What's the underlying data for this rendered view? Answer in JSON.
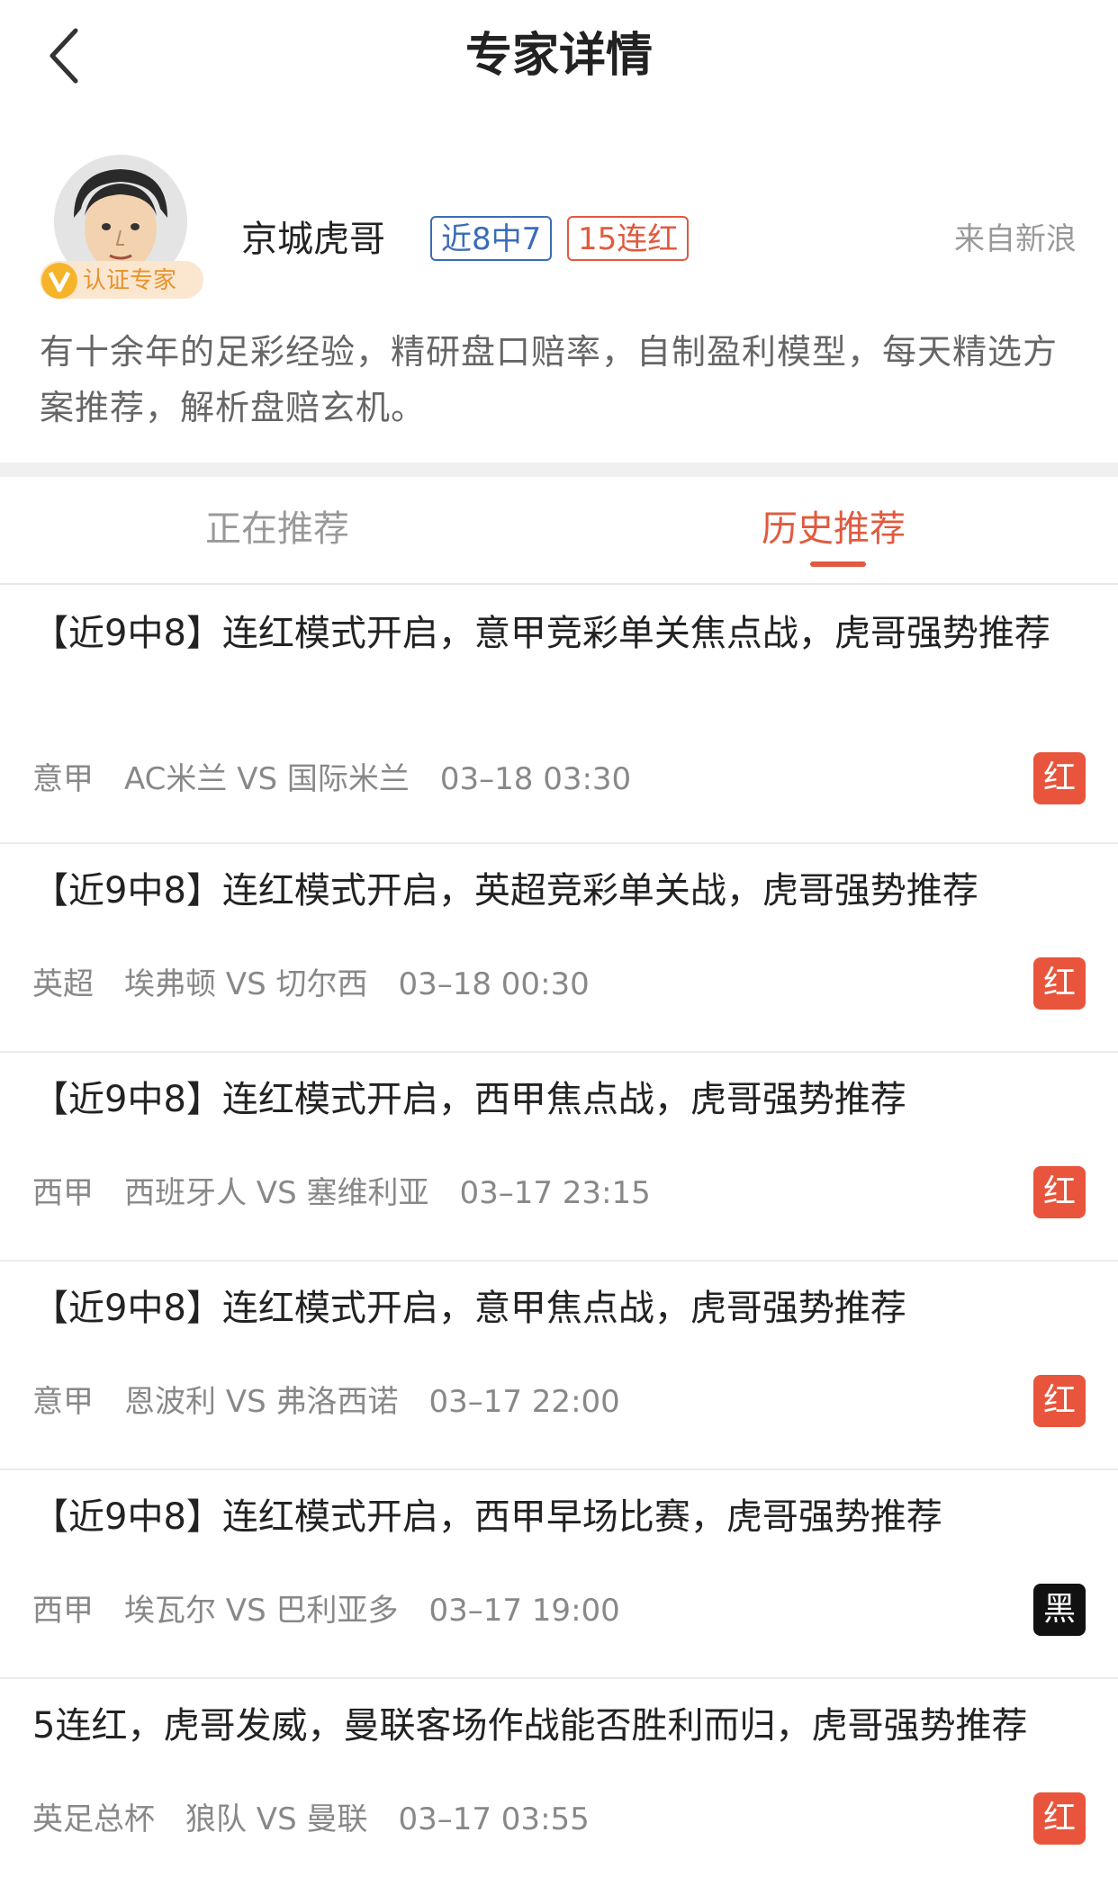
{
  "header": {
    "title": "专家详情",
    "back_icon": "chevron-left-icon"
  },
  "expert": {
    "name": "京城虎哥",
    "tag_recent": "近8中7",
    "tag_streak": "15连红",
    "source": "来自新浪",
    "verified_label": "认证专家",
    "verified_icon": "v-badge-icon",
    "intro": "有十余年的足彩经验，精研盘口赔率，自制盈利模型，每天精选方案推荐，解析盘赔玄机。"
  },
  "tabs": [
    {
      "label": "正在推荐",
      "active": false
    },
    {
      "label": "历史推荐",
      "active": true
    }
  ],
  "colors": {
    "accent": "#e05a3f",
    "blue_tag": "#3b6cb8",
    "red_result": "#e8553c",
    "black_result": "#111111"
  },
  "items": [
    {
      "title": "【近9中8】连红模式开启，意甲竞彩单关焦点战，虎哥强势推荐",
      "league": "意甲",
      "match": "AC米兰 VS 国际米兰",
      "time": "03–18 03:30",
      "result": "红"
    },
    {
      "title": "【近9中8】连红模式开启，英超竞彩单关战，虎哥强势推荐",
      "league": "英超",
      "match": "埃弗顿 VS 切尔西",
      "time": "03–18 00:30",
      "result": "红"
    },
    {
      "title": "【近9中8】连红模式开启，西甲焦点战，虎哥强势推荐",
      "league": "西甲",
      "match": "西班牙人 VS 塞维利亚",
      "time": "03–17 23:15",
      "result": "红"
    },
    {
      "title": "【近9中8】连红模式开启，意甲焦点战，虎哥强势推荐",
      "league": "意甲",
      "match": "恩波利 VS 弗洛西诺",
      "time": "03–17 22:00",
      "result": "红"
    },
    {
      "title": "【近9中8】连红模式开启，西甲早场比赛，虎哥强势推荐",
      "league": "西甲",
      "match": "埃瓦尔 VS 巴利亚多",
      "time": "03–17 19:00",
      "result": "黑"
    },
    {
      "title": "5连红，虎哥发威，曼联客场作战能否胜利而归，虎哥强势推荐",
      "league": "英足总杯",
      "match": "狼队 VS 曼联",
      "time": "03–17 03:55",
      "result": "红"
    }
  ]
}
